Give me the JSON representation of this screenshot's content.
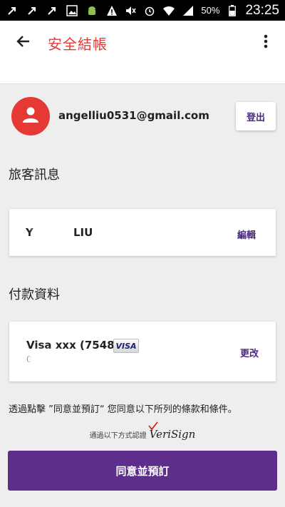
{
  "status_bar": {
    "battery_percent": "50%",
    "time": "23:25",
    "icons": [
      "notification-icon",
      "notification-icon",
      "notification-icon",
      "image-icon",
      "android-icon",
      "warning-icon",
      "mute-icon",
      "alarm-icon",
      "wifi-icon",
      "signal-icon",
      "battery-icon"
    ]
  },
  "app_bar": {
    "title": "安全結帳",
    "back_icon": "back-arrow-icon",
    "menu_icon": "more-vert-icon"
  },
  "account": {
    "email": "angelliu0531@gmail.com",
    "logout_label": "登出",
    "avatar_icon": "person-icon"
  },
  "traveller": {
    "section_title": "旅客訊息",
    "name_visible_prefix": "Y",
    "name_visible_suffix": "LIU",
    "edit_label": "編輯"
  },
  "payment": {
    "section_title": "付款資料",
    "card_label": "Visa xxx (7548)",
    "card_brand": "VISA",
    "card_sub_visible": "0",
    "change_label": "更改"
  },
  "terms_text": "透過點擊 ”同意並預訂“ 您同意以下所列的條款和條件。",
  "verification": {
    "text": "通過以下方式認證",
    "logo_text": "VeriSign"
  },
  "agree_button_label": "同意並預訂",
  "colors": {
    "accent_red": "#e53935",
    "primary_purple": "#5d2e8c",
    "link_purple": "#4a2a7f",
    "background": "#eeeeee"
  }
}
